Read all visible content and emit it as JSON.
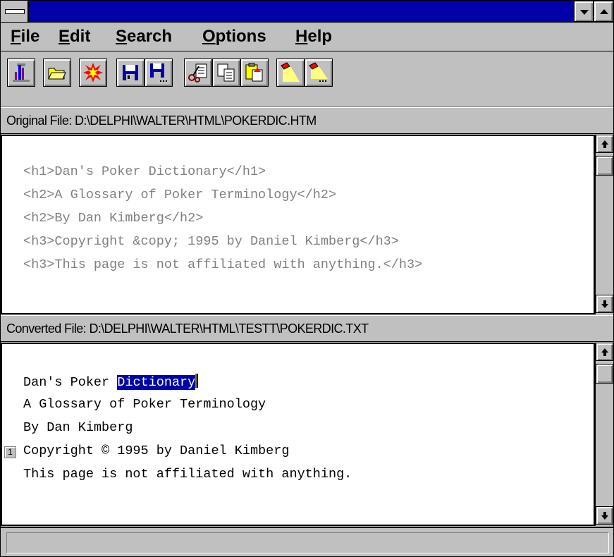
{
  "menu": {
    "items": [
      "File",
      "Edit",
      "Search",
      "Options",
      "Help"
    ]
  },
  "toolbar": {
    "buttons": [
      "exit-icon",
      "open-folder-icon",
      "convert-burst-icon",
      "save-icon",
      "save-as-icon",
      "cut-icon",
      "copy-icon",
      "paste-icon",
      "find-flashlight-icon",
      "find-next-flashlight-icon"
    ]
  },
  "original": {
    "label": "Original File: D:\\DELPHI\\WALTER\\HTML\\POKERDIC.HTM",
    "lines": [
      "<h1>Dan's Poker Dictionary</h1>",
      "<h2>A Glossary of Poker Terminology</h2>",
      "<h2>By Dan Kimberg</h2>",
      "<h3>Copyright &copy; 1995 by Daniel Kimberg</h3>",
      "<h3>This page is not affiliated with anything.</h3>"
    ]
  },
  "converted": {
    "label": "Converted File: D:\\DELPHI\\WALTER\\HTML\\TESTT\\POKERDIC.TXT",
    "line1_prefix": "Dan's Poker ",
    "line1_selected": "Dictionary",
    "lines": [
      "A Glossary of Poker Terminology",
      "By Dan Kimberg",
      "Copyright © 1995 by Daniel Kimberg",
      "This page is not affiliated with anything."
    ],
    "bookmark": "1"
  },
  "colors": {
    "titlebar": "#0000a8",
    "selection": "#0000a8",
    "chrome": "#c0c0c0"
  }
}
